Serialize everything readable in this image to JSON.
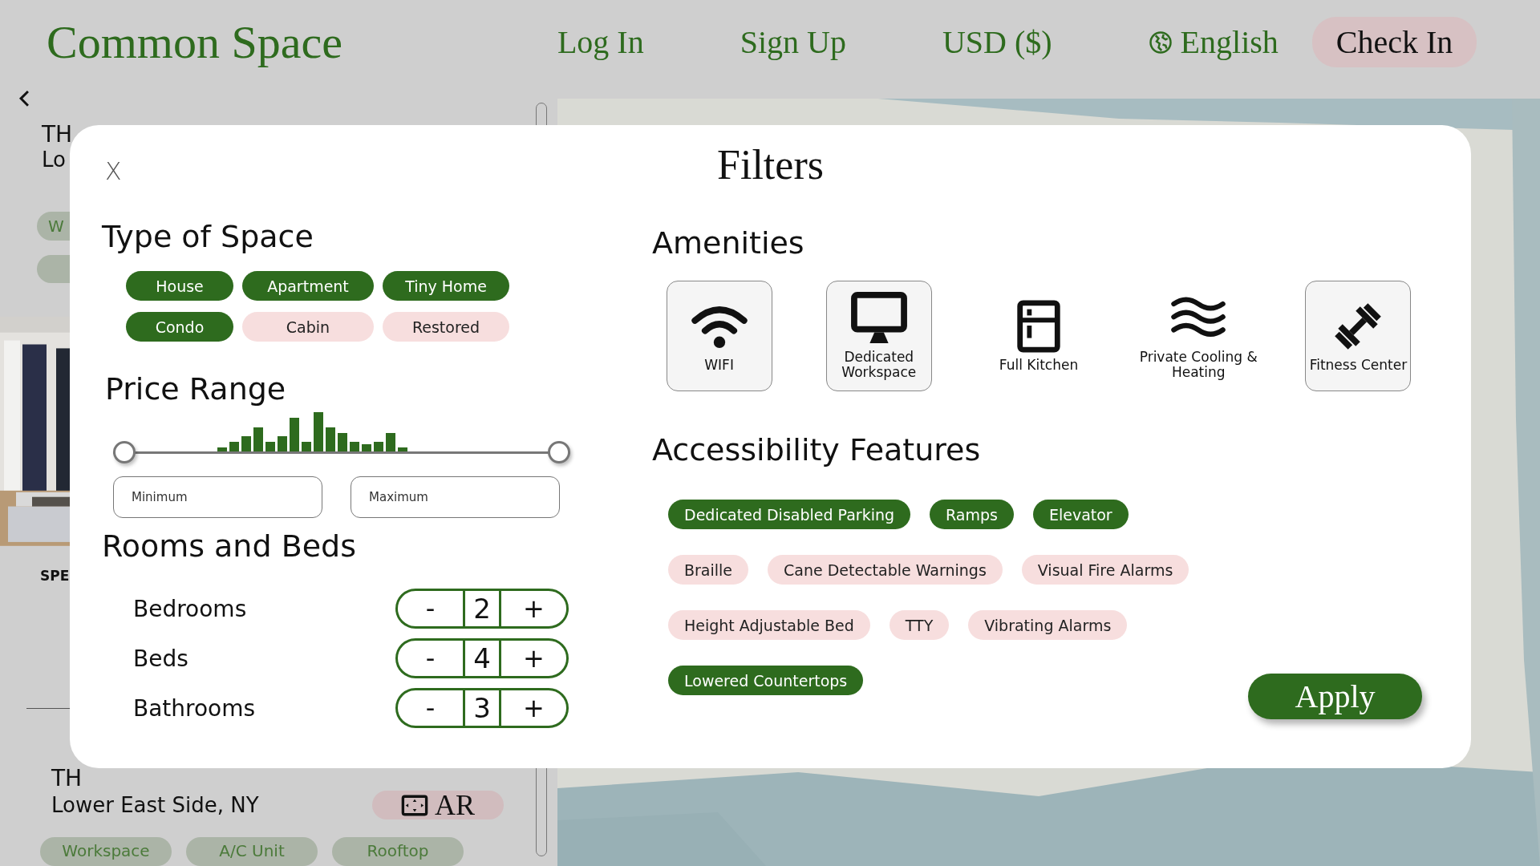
{
  "header": {
    "logo": "Common Space",
    "nav": [
      {
        "label": "Log In",
        "kind": "link"
      },
      {
        "label": "Sign Up",
        "kind": "link"
      },
      {
        "label": "USD ($)",
        "kind": "link"
      },
      {
        "label": "English",
        "kind": "language"
      }
    ],
    "check_in": "Check In"
  },
  "listings": {
    "first": {
      "title": "TH",
      "location": "Lo",
      "tag": "W"
    },
    "section_label": "SPE",
    "second": {
      "title": "TH",
      "location": "Lower East Side, NY",
      "ar_label": "AR",
      "tags": [
        "Workspace",
        "A/C Unit",
        "Rooftop"
      ]
    }
  },
  "filters": {
    "title": "Filters",
    "close": "X",
    "type_of_space": {
      "heading": "Type of Space",
      "options": [
        {
          "label": "House",
          "selected": true
        },
        {
          "label": "Apartment",
          "selected": true
        },
        {
          "label": "Tiny Home",
          "selected": true
        },
        {
          "label": "Condo",
          "selected": true
        },
        {
          "label": "Cabin",
          "selected": false
        },
        {
          "label": "Restored",
          "selected": false
        }
      ]
    },
    "price_range": {
      "heading": "Price Range",
      "min_thumb": {
        "level": 0
      },
      "max_thumb": {
        "level": 1
      },
      "min_placeholder": "Minimum",
      "max_placeholder": "Maximum"
    },
    "rooms": {
      "heading": "Rooms and Beds",
      "rows": [
        {
          "label": "Bedrooms",
          "decrement": "-",
          "value": "2",
          "increment": "+"
        },
        {
          "label": "Beds",
          "decrement": "-",
          "value": "4",
          "increment": "+"
        },
        {
          "label": "Bathrooms",
          "decrement": "-",
          "value": "3",
          "increment": "+"
        }
      ]
    },
    "amenities": {
      "heading": "Amenities",
      "items": [
        {
          "label": "WIFI",
          "kind": "wifi",
          "selected": true
        },
        {
          "label": "Dedicated Workspace",
          "kind": "monitor",
          "selected": true
        },
        {
          "label": "Full Kitchen",
          "kind": "fridge",
          "selected": false
        },
        {
          "label": "Private Cooling & Heating",
          "kind": "waves",
          "selected": false
        },
        {
          "label": "Fitness Center",
          "kind": "dumbbell",
          "selected": true
        }
      ]
    },
    "accessibility": {
      "heading": "Accessibility Features",
      "rows": [
        {
          "tags": [
            {
              "label": "Dedicated Disabled Parking",
              "selected": true
            },
            {
              "label": "Ramps",
              "selected": true
            },
            {
              "label": "Elevator",
              "selected": true
            }
          ]
        },
        {
          "tags": [
            {
              "label": "Braille",
              "selected": false
            },
            {
              "label": "Cane Detectable Warnings",
              "selected": false
            },
            {
              "label": "Visual Fire Alarms",
              "selected": false
            }
          ]
        },
        {
          "tags": [
            {
              "label": "Height Adjustable Bed",
              "selected": false
            },
            {
              "label": "TTY",
              "selected": false
            },
            {
              "label": "Vibrating Alarms",
              "selected": false
            }
          ]
        },
        {
          "tags": [
            {
              "label": "Lowered Countertops",
              "selected": true
            }
          ]
        }
      ]
    },
    "apply": "Apply"
  }
}
